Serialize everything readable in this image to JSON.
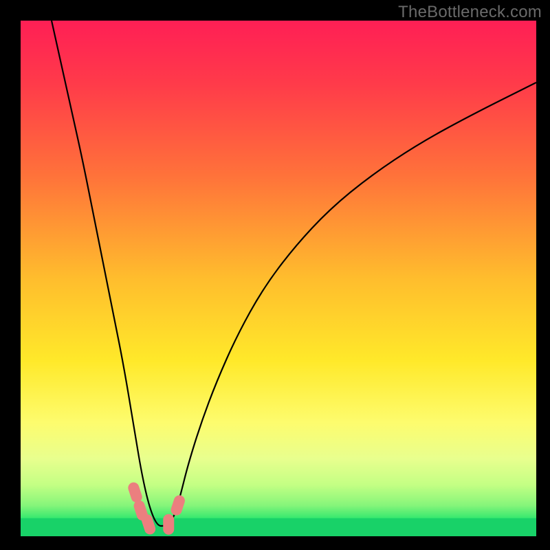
{
  "watermark": "TheBottleneck.com",
  "chart_data": {
    "type": "line",
    "title": "",
    "xlabel": "",
    "ylabel": "",
    "xlim": [
      0,
      100
    ],
    "ylim": [
      0,
      100
    ],
    "background_gradient": {
      "stops": [
        {
          "offset": 0.0,
          "color": "#ff1f55"
        },
        {
          "offset": 0.12,
          "color": "#ff3a4a"
        },
        {
          "offset": 0.3,
          "color": "#ff723a"
        },
        {
          "offset": 0.5,
          "color": "#ffbd2d"
        },
        {
          "offset": 0.66,
          "color": "#ffe92a"
        },
        {
          "offset": 0.78,
          "color": "#fdfc6e"
        },
        {
          "offset": 0.85,
          "color": "#e8ff8e"
        },
        {
          "offset": 0.9,
          "color": "#c4ff84"
        },
        {
          "offset": 0.94,
          "color": "#86f57a"
        },
        {
          "offset": 0.965,
          "color": "#37e86f"
        },
        {
          "offset": 1.0,
          "color": "#18d268"
        }
      ]
    },
    "series": [
      {
        "name": "bottleneck-curve",
        "color": "#000000",
        "x": [
          6.0,
          8.0,
          10.0,
          12.0,
          14.0,
          16.0,
          18.0,
          20.0,
          22.0,
          23.5,
          25.0,
          26.5,
          28.0,
          29.0,
          30.0,
          31.0,
          32.5,
          35.0,
          38.0,
          42.0,
          47.0,
          53.0,
          60.0,
          68.0,
          77.0,
          87.0,
          100.0
        ],
        "values": [
          100.0,
          91.0,
          82.0,
          73.0,
          63.0,
          53.0,
          43.0,
          33.0,
          21.0,
          12.0,
          5.5,
          2.0,
          2.0,
          2.5,
          4.5,
          8.0,
          14.0,
          22.0,
          30.0,
          39.0,
          48.0,
          56.0,
          63.5,
          70.0,
          76.0,
          81.5,
          88.0
        ]
      }
    ],
    "markers": [
      {
        "x": 22.2,
        "y": 8.5,
        "color": "#eb7f7f"
      },
      {
        "x": 23.3,
        "y": 5.0,
        "color": "#eb7f7f"
      },
      {
        "x": 24.8,
        "y": 2.3,
        "color": "#eb7f7f"
      },
      {
        "x": 28.7,
        "y": 2.3,
        "color": "#eb7f7f"
      },
      {
        "x": 30.5,
        "y": 6.0,
        "color": "#eb7f7f"
      }
    ],
    "baseline_band": {
      "y_from": 0,
      "y_to": 3.5,
      "color": "#18d268"
    }
  }
}
